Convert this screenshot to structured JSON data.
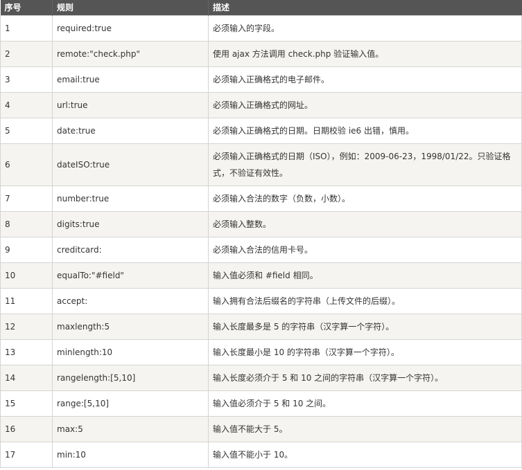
{
  "table": {
    "headers": [
      "序号",
      "规则",
      "描述"
    ],
    "rows": [
      {
        "no": "1",
        "rule": "required:true",
        "desc": "必须输入的字段。"
      },
      {
        "no": "2",
        "rule": "remote:\"check.php\"",
        "desc": "使用 ajax 方法调用 check.php 验证输入值。"
      },
      {
        "no": "3",
        "rule": "email:true",
        "desc": "必须输入正确格式的电子邮件。"
      },
      {
        "no": "4",
        "rule": "url:true",
        "desc": "必须输入正确格式的网址。"
      },
      {
        "no": "5",
        "rule": "date:true",
        "desc": "必须输入正确格式的日期。日期校验 ie6 出错，慎用。"
      },
      {
        "no": "6",
        "rule": "dateISO:true",
        "desc": "必须输入正确格式的日期（ISO），例如：2009-06-23，1998/01/22。只验证格式，不验证有效性。"
      },
      {
        "no": "7",
        "rule": "number:true",
        "desc": "必须输入合法的数字（负数，小数）。"
      },
      {
        "no": "8",
        "rule": "digits:true",
        "desc": "必须输入整数。"
      },
      {
        "no": "9",
        "rule": "creditcard:",
        "desc": "必须输入合法的信用卡号。"
      },
      {
        "no": "10",
        "rule": "equalTo:\"#field\"",
        "desc": "输入值必须和 #field 相同。"
      },
      {
        "no": "11",
        "rule": "accept:",
        "desc": "输入拥有合法后缀名的字符串（上传文件的后缀）。"
      },
      {
        "no": "12",
        "rule": "maxlength:5",
        "desc": "输入长度最多是 5 的字符串（汉字算一个字符）。"
      },
      {
        "no": "13",
        "rule": "minlength:10",
        "desc": "输入长度最小是 10 的字符串（汉字算一个字符）。"
      },
      {
        "no": "14",
        "rule": "rangelength:[5,10]",
        "desc": "输入长度必须介于 5 和 10 之间的字符串（汉字算一个字符）。"
      },
      {
        "no": "15",
        "rule": "range:[5,10]",
        "desc": "输入值必须介于 5 和 10 之间。"
      },
      {
        "no": "16",
        "rule": "max:5",
        "desc": "输入值不能大于 5。"
      },
      {
        "no": "17",
        "rule": "min:10",
        "desc": "输入值不能小于 10。"
      }
    ]
  },
  "colors": {
    "header_bg": "#555555",
    "header_text": "#ffffff",
    "row_alt_bg": "#f6f4f0",
    "border": "#d4d4d4"
  }
}
